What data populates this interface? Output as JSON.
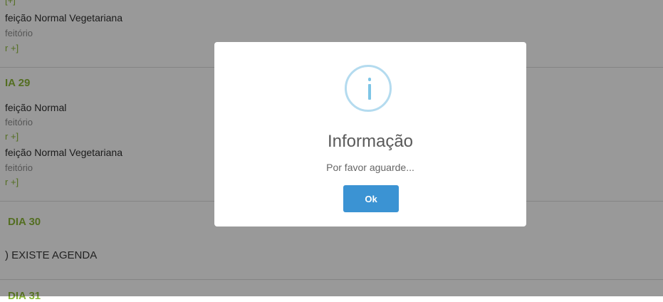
{
  "background_list": {
    "top_block": {
      "meal_link": "[+]",
      "meal_name": "feição Normal Vegetariana",
      "location": "feitório",
      "more_link": "r +]"
    },
    "day29": {
      "label": "IA 29",
      "meals": [
        {
          "name": "feição Normal",
          "location": "feitório",
          "more_link": "r +]"
        },
        {
          "name": "feição Normal Vegetariana",
          "location": "feitório",
          "more_link": "r +]"
        }
      ]
    },
    "day30": {
      "label": "DIA 30",
      "no_agenda": ") EXISTE AGENDA"
    },
    "day31": {
      "label": "DIA 31"
    }
  },
  "dialog": {
    "icon": "info-icon",
    "title": "Informação",
    "message": "Por favor aguarde...",
    "ok_label": "Ok"
  },
  "colors": {
    "accent_green": "#8cb83a",
    "button_blue": "#3b93d3",
    "info_icon": "#7ec5e6"
  }
}
